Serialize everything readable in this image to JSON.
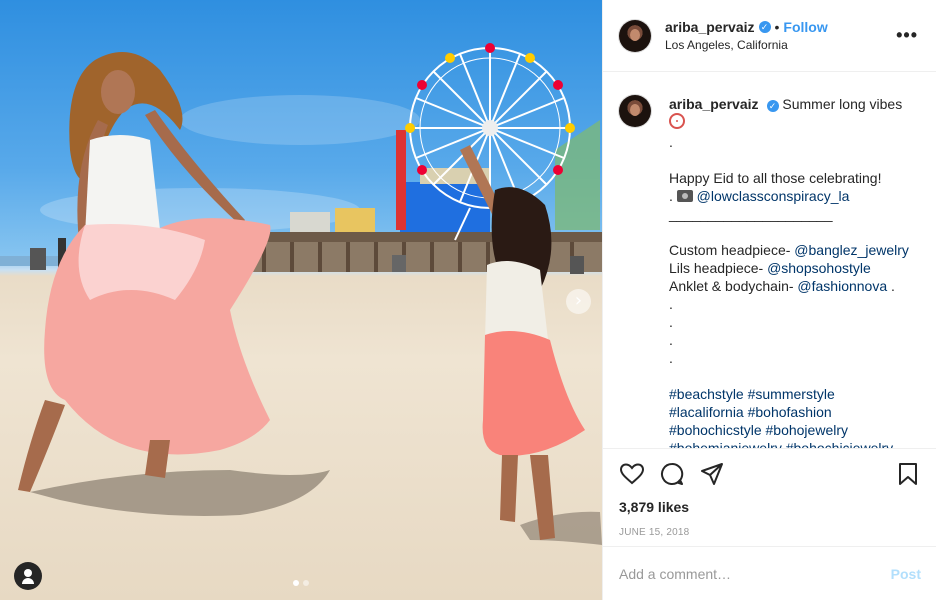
{
  "colors": {
    "accent": "#3897f0",
    "hashtag": "#003569",
    "post_disabled": "#b2dffc"
  },
  "header": {
    "username": "ariba_pervaiz",
    "follow_label": "Follow",
    "separator": "•",
    "location": "Los Angeles, California",
    "more_icon": "more-options-icon",
    "verified_icon": "verified-badge-icon"
  },
  "photo": {
    "next_icon": "chevron-right-icon",
    "carousel": {
      "count": 2,
      "active": 1
    },
    "tag_icon": "user-tag-icon"
  },
  "caption": {
    "username": "ariba_pervaiz",
    "title": "Summer long vibes",
    "lines": [
      ".",
      "",
      "Happy Eid to all those celebrating!",
      ". ",
      "@lowclassconspiracy_la",
      "_____________________",
      "",
      "Custom headpiece- ",
      "@banglez_jewelry",
      "Lils headpiece- ",
      "@shopsohostyle",
      "Anklet & bodychain- ",
      "@fashionnova",
      " .",
      ".",
      ".",
      ".",
      ".",
      "",
      "#beachstyle #summerstyle",
      "#lacalifornia #bohofashion",
      "#bohochicstyle #bohojewelry",
      "#bohemianjewelry #bohochicjewelry"
    ]
  },
  "actions": {
    "like_icon": "heart-icon",
    "comment_icon": "comment-icon",
    "share_icon": "share-icon",
    "save_icon": "bookmark-icon",
    "likes": "3,879 likes",
    "date": "JUNE 15, 2018"
  },
  "comment_box": {
    "placeholder": "Add a comment…",
    "post_label": "Post"
  }
}
